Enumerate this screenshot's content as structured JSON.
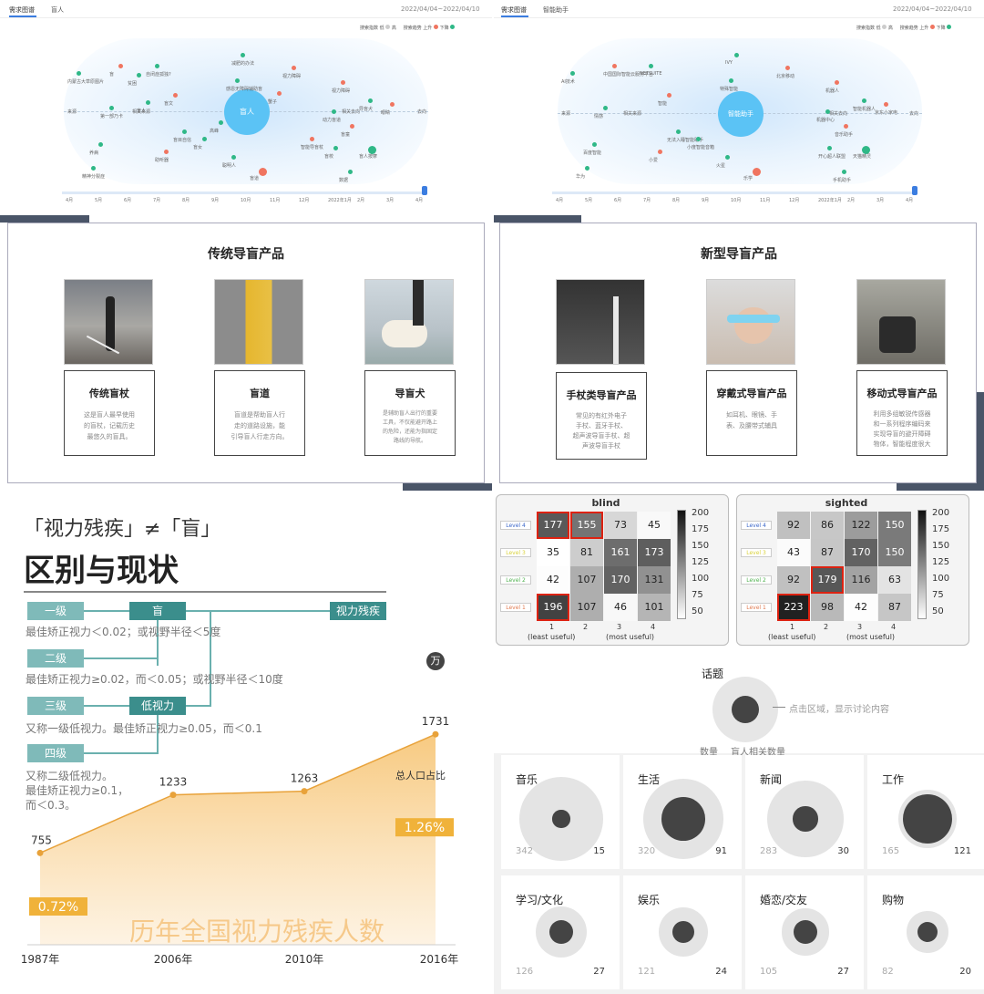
{
  "top_left": {
    "tabs": [
      "需求图谱",
      "盲人"
    ],
    "date": "2022/04/04~2022/04/10",
    "legend": [
      "搜索指数",
      "低",
      "高",
      "搜索趋势",
      "上升",
      "下降"
    ],
    "center": "盲人",
    "side_labels": [
      "来源",
      "相关来源",
      "相关去向",
      "去向"
    ],
    "keywords": [
      "盲",
      "内蒙古大草原图片",
      "自闭症孤独?",
      "盲文",
      "第一部乃卡",
      "盲目自信",
      "视力障碍",
      "减肥的办法",
      "感恩无障碍辅助盲",
      "视力障碍",
      "导盲犬",
      "动力盲道",
      "盲童",
      "盲校",
      "盲人按摩",
      "眼睛",
      "养病",
      "精神分裂症",
      "助听器",
      "盲女",
      "聪明人",
      "盲道",
      "数据",
      "盲人",
      "蟹子",
      "贫困",
      "高峰",
      "智能导盲杖"
    ],
    "months": [
      "4月",
      "5月",
      "6月",
      "7月",
      "8月",
      "9月",
      "10月",
      "11月",
      "12月",
      "2022年1月",
      "2月",
      "3月",
      "4月"
    ]
  },
  "top_right": {
    "tabs": [
      "需求图谱",
      "智能助手"
    ],
    "date": "2022/04/04~2022/04/10",
    "legend": [
      "搜索指数",
      "低",
      "高",
      "搜索趋势",
      "上升",
      "下降"
    ],
    "center": "智能助手",
    "side_labels": [
      "来源",
      "相关来源",
      "相关去向",
      "去向"
    ],
    "keywords": [
      "中国国际智能云服务平台",
      "AI技术",
      "NETSUITE",
      "智能",
      "情感",
      "无法入睡智能助手",
      "北京移动",
      "IVY",
      "特殊智能",
      "机器人",
      "智能机器人",
      "机器中心",
      "音乐助手",
      "开心超人联盟",
      "天猫精灵",
      "京东小家电",
      "百度智能",
      "华为",
      "小爱",
      "小度智能音箱",
      "火星",
      "乐学",
      "手机助手"
    ],
    "months": [
      "4月",
      "5月",
      "6月",
      "7月",
      "8月",
      "9月",
      "10月",
      "11月",
      "12月",
      "2022年1月",
      "2月",
      "3月",
      "4月"
    ]
  },
  "traditional": {
    "title": "传统导盲产品",
    "cards": [
      {
        "name": "传统盲杖",
        "desc": [
          "这是盲人最早使用",
          "的盲杖，记载历史",
          "最悠久的盲具。"
        ]
      },
      {
        "name": "盲道",
        "desc": [
          "盲道是帮助盲人行",
          "走的道路设施，能",
          "引导盲人行走方向。"
        ]
      },
      {
        "name": "导盲犬",
        "desc": [
          "是辅助盲人出行的重要",
          "工具，不仅能避开路上",
          "的危险，还能为指固定",
          "路线的导航。"
        ]
      }
    ]
  },
  "new_products": {
    "title": "新型导盲产品",
    "cards": [
      {
        "name": "手杖类导盲产品",
        "desc": [
          "常见的有红外电子",
          "手杖、蓝牙手杖、",
          "超声波导盲手杖、超",
          "声波导盲手杖"
        ]
      },
      {
        "name": "穿戴式导盲产品",
        "desc": [
          "如耳机、眼镜、手",
          "表、及腰带式辅具"
        ]
      },
      {
        "name": "移动式导盲产品",
        "desc": [
          "利用多组敏锐传感器",
          "和一系列程序编码来",
          "实现导盲的避开障碍",
          "物体，智能程度很大"
        ]
      }
    ]
  },
  "vision": {
    "subtitle": "「视力残疾」≠「盲」",
    "title": "区别与现状",
    "levels": [
      "一级",
      "二级",
      "三级",
      "四级"
    ],
    "groups": [
      "盲",
      "低视力",
      "视力残疾"
    ],
    "descs": [
      "最佳矫正视力＜0.02；或视野半径＜5度",
      "最佳矫正视力≥0.02，而＜0.05；或视野半径＜10度",
      "又称一级低视力。最佳矫正视力≥0.05，而＜0.1",
      "又称二级低视力。",
      "最佳矫正视力≥0.1，",
      "而＜0.3。"
    ],
    "unit": "万",
    "ratio_label": "总人口占比",
    "caption": "历年全国视力残疾人数"
  },
  "chart_data": {
    "type": "area",
    "categories": [
      "1987年",
      "2006年",
      "2010年",
      "2016年"
    ],
    "values": [
      755,
      1233,
      1263,
      1731
    ],
    "unit": "万",
    "annotations": [
      {
        "at": "1987年",
        "text": "0.72%"
      },
      {
        "at": "2016年",
        "text": "1.26%"
      }
    ],
    "ylim": [
      0,
      1800
    ]
  },
  "heatmaps": [
    {
      "title": "blind",
      "rows": [
        "Level 4",
        "Level 3",
        "Level 2",
        "Level 1"
      ],
      "values": [
        [
          177,
          155,
          73,
          45
        ],
        [
          35,
          81,
          161,
          173
        ],
        [
          42,
          107,
          170,
          131
        ],
        [
          196,
          107,
          46,
          101
        ]
      ],
      "highlight": [
        [
          0,
          0
        ],
        [
          0,
          1
        ],
        [
          3,
          0
        ]
      ]
    },
    {
      "title": "sighted",
      "rows": [
        "Level 4",
        "Level 3",
        "Level 2",
        "Level 1"
      ],
      "values": [
        [
          92,
          86,
          122,
          150
        ],
        [
          43,
          87,
          170,
          150
        ],
        [
          92,
          179,
          116,
          63
        ],
        [
          223,
          98,
          42,
          87
        ]
      ],
      "highlight": [
        [
          2,
          1
        ],
        [
          3,
          0
        ]
      ]
    }
  ],
  "heat_axis": {
    "x": [
      "1",
      "2",
      "3",
      "4"
    ],
    "x_notes": [
      "(least useful)",
      "(most useful)"
    ],
    "scale": [
      "200",
      "175",
      "150",
      "125",
      "100",
      "75",
      "50"
    ]
  },
  "topics": {
    "header": "话题",
    "legend_note": "点击区域，显示讨论内容",
    "legend_left": "数量",
    "legend_right": "盲人相关数量",
    "items": [
      {
        "name": "音乐",
        "total": 342,
        "related": 15
      },
      {
        "name": "生活",
        "total": 320,
        "related": 91
      },
      {
        "name": "新闻",
        "total": 283,
        "related": 30
      },
      {
        "name": "工作",
        "total": 165,
        "related": 121
      },
      {
        "name": "学习/文化",
        "total": 126,
        "related": 27
      },
      {
        "name": "娱乐",
        "total": 121,
        "related": 24
      },
      {
        "name": "婚恋/交友",
        "total": 105,
        "related": 27
      },
      {
        "name": "购物",
        "total": 82,
        "related": 20
      }
    ]
  }
}
